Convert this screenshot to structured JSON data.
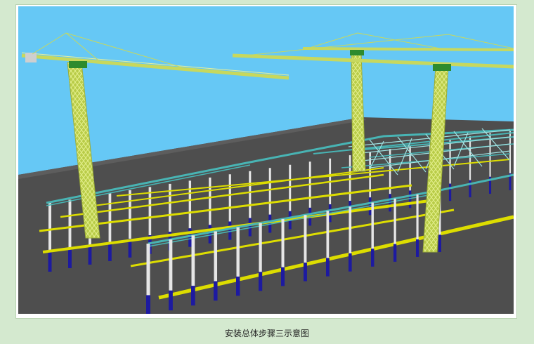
{
  "caption": "安装总体步骤三示意图",
  "colors": {
    "sky": "#66c8f5",
    "ground": "#4e4e4e",
    "crane": "#c7d85e",
    "column_base": "#1d1aa0",
    "column_upper": "#e6e6e6",
    "beam_yellow": "#dddd00",
    "truss_teal": "#48b4b4"
  },
  "icons": [
    "tower-crane-icon",
    "steel-frame-icon"
  ]
}
